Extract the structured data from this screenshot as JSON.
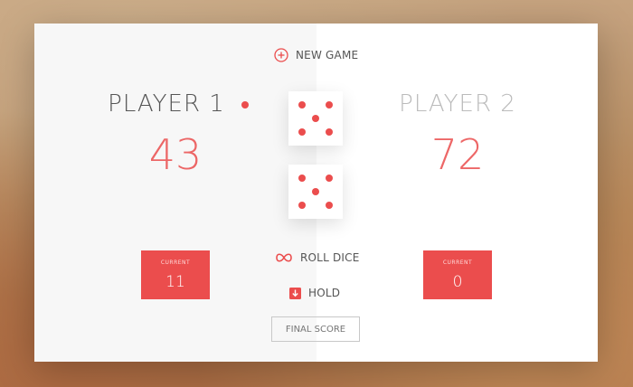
{
  "controls": {
    "new_game": "NEW GAME",
    "roll_dice": "ROLL DICE",
    "hold": "HOLD",
    "final_score_placeholder": "FINAL SCORE"
  },
  "players": [
    {
      "name": "PLAYER 1",
      "total": "43",
      "current_label": "CURRENT",
      "current": "11",
      "active": true
    },
    {
      "name": "PLAYER 2",
      "total": "72",
      "current_label": "CURRENT",
      "current": "0",
      "active": false
    }
  ],
  "dice": [
    {
      "value": 5
    },
    {
      "value": 5
    }
  ],
  "colors": {
    "accent": "#eb4d4d",
    "left_panel": "#f7f7f7",
    "right_panel": "#ffffff"
  },
  "icons": {
    "new_game": "plus-circle-icon",
    "roll_dice": "infinity-icon",
    "hold": "download-box-icon"
  }
}
